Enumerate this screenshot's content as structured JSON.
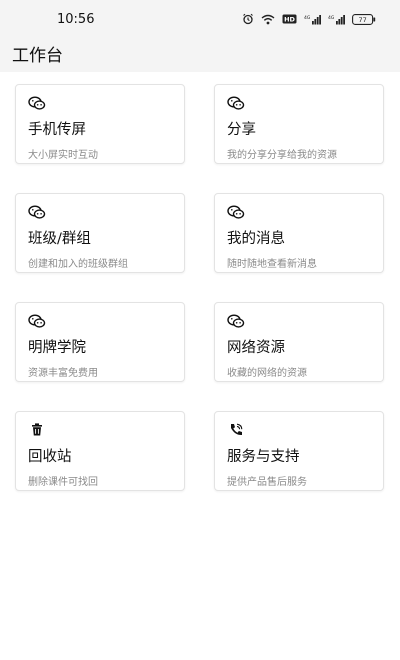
{
  "status": {
    "time": "10:56",
    "icons": [
      "alarm-icon",
      "wifi-icon",
      "hd-icon",
      "signal-icon",
      "signal-icon",
      "battery-icon"
    ],
    "battery": "77"
  },
  "header": {
    "title": "工作台"
  },
  "cards": [
    {
      "title": "手机传屏",
      "subtitle": "大小屏实时互动",
      "icon": "wechat-icon"
    },
    {
      "title": "分享",
      "subtitle": "我的分享分享给我的资源",
      "icon": "wechat-icon"
    },
    {
      "title": "班级/群组",
      "subtitle": "创建和加入的班级群组",
      "icon": "wechat-icon"
    },
    {
      "title": "我的消息",
      "subtitle": "随时随地查看新消息",
      "icon": "wechat-icon"
    },
    {
      "title": "明牌学院",
      "subtitle": "资源丰富免费用",
      "icon": "wechat-icon"
    },
    {
      "title": "网络资源",
      "subtitle": "收藏的网络的资源",
      "icon": "wechat-icon"
    },
    {
      "title": "回收站",
      "subtitle": "删除课件可找回",
      "icon": "trash-icon"
    },
    {
      "title": "服务与支持",
      "subtitle": "提供产品售后服务",
      "icon": "phone-icon"
    }
  ]
}
